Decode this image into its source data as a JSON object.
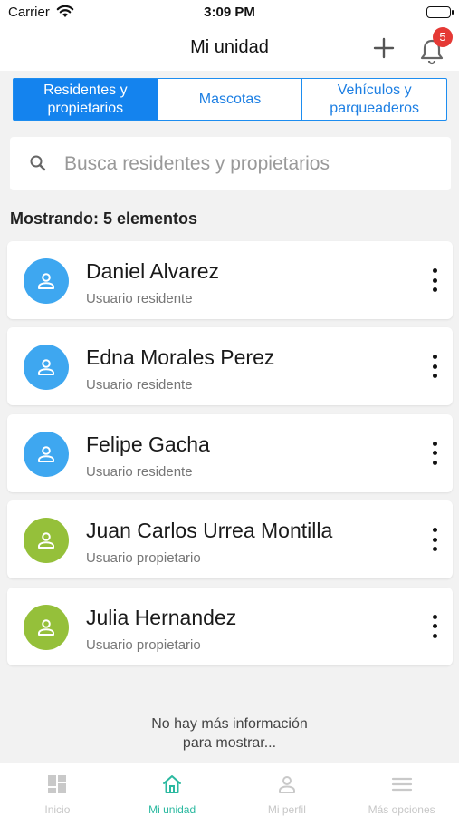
{
  "status_bar": {
    "carrier": "Carrier",
    "time": "3:09 PM"
  },
  "header": {
    "title": "Mi unidad",
    "notification_count": "5"
  },
  "segments": [
    {
      "label": "Residentes y propietarios",
      "active": true
    },
    {
      "label": "Mascotas",
      "active": false
    },
    {
      "label": "Vehículos y parqueaderos",
      "active": false
    }
  ],
  "search": {
    "placeholder": "Busca residentes y propietarios",
    "value": ""
  },
  "count_label": "Mostrando: 5 elementos",
  "residents": [
    {
      "name": "Daniel Alvarez",
      "role": "Usuario residente",
      "avatar_color": "#3ea7f0"
    },
    {
      "name": "Edna Morales Perez",
      "role": "Usuario residente",
      "avatar_color": "#3ea7f0"
    },
    {
      "name": "Felipe Gacha",
      "role": "Usuario residente",
      "avatar_color": "#3ea7f0"
    },
    {
      "name": "Juan Carlos Urrea Montilla",
      "role": "Usuario propietario",
      "avatar_color": "#95c03a"
    },
    {
      "name": "Julia Hernandez",
      "role": "Usuario propietario",
      "avatar_color": "#95c03a"
    }
  ],
  "footer_message": "No hay más información\npara mostrar...",
  "tabs": [
    {
      "label": "Inicio",
      "icon": "dashboard-icon",
      "active": false
    },
    {
      "label": "Mi unidad",
      "icon": "home-icon",
      "active": true
    },
    {
      "label": "Mi perfil",
      "icon": "profile-icon",
      "active": false
    },
    {
      "label": "Más opciones",
      "icon": "menu-icon",
      "active": false
    }
  ],
  "colors": {
    "primary_blue": "#1483ee",
    "active_tab": "#2bb9a0",
    "badge_red": "#e53935"
  }
}
